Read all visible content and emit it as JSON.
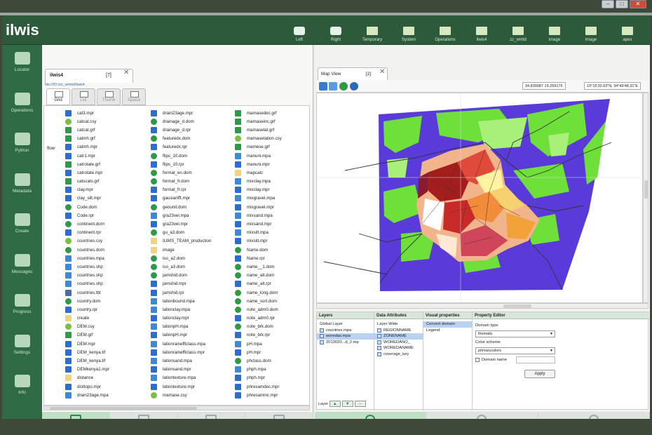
{
  "app": {
    "title": "ilwis"
  },
  "colors": {
    "header": "#2d5a3a",
    "sidebar": "#2f6b45",
    "accent": "#bfe0c4"
  },
  "topbar": [
    {
      "label": "Left",
      "icon": "camera-left-icon"
    },
    {
      "label": "Right",
      "icon": "camera-right-icon"
    },
    {
      "label": "Temporary",
      "icon": "folder-icon"
    },
    {
      "label": "System",
      "icon": "folder-icon"
    },
    {
      "label": "Operations",
      "icon": "folder-icon"
    },
    {
      "label": "ilwis4",
      "icon": "folder-icon"
    },
    {
      "label": "zz_wmtd",
      "icon": "folder-icon"
    },
    {
      "label": "image",
      "icon": "folder-icon"
    },
    {
      "label": "image",
      "icon": "folder-icon"
    },
    {
      "label": "apex",
      "icon": "folder-icon"
    }
  ],
  "sidebar": [
    {
      "label": "Locator",
      "icon": "locator-icon"
    },
    {
      "label": "Operations",
      "icon": "gears-icon"
    },
    {
      "label": "Python",
      "icon": "python-icon"
    },
    {
      "label": "Metadata",
      "icon": "tag-icon"
    },
    {
      "label": "Create",
      "icon": "create-icon"
    },
    {
      "label": "Messages",
      "icon": "message-icon"
    },
    {
      "label": "Progress",
      "icon": "progress-icon"
    },
    {
      "label": "Settings",
      "icon": "gear-icon"
    },
    {
      "label": "Info",
      "icon": "info-icon"
    }
  ],
  "catalog": {
    "tab_name": "ilwis4",
    "tab_count": "[7]",
    "path": "file:///D:/zz_wmtd/ilwis4",
    "side_label": "flow",
    "view_tabs": [
      "Grid",
      "List",
      "Thumb",
      "Spatial"
    ],
    "columns": [
      [
        {
          "name": "cat3.mpr",
          "type": "raster"
        },
        {
          "name": "catcat.csy",
          "type": "csy"
        },
        {
          "name": "catcat.grf",
          "type": "grf"
        },
        {
          "name": "catmh.grf",
          "type": "grf"
        },
        {
          "name": "catmh.mpr",
          "type": "raster"
        },
        {
          "name": "catr1.mpr",
          "type": "raster"
        },
        {
          "name": "catrotate.grf",
          "type": "grf"
        },
        {
          "name": "catrotate.mpr",
          "type": "raster"
        },
        {
          "name": "catscats.grf",
          "type": "grf"
        },
        {
          "name": "clay.mpr",
          "type": "raster"
        },
        {
          "name": "clay_silt.mpr",
          "type": "raster"
        },
        {
          "name": "Code.dom",
          "type": "dom"
        },
        {
          "name": "Code.rpr",
          "type": "rpr"
        },
        {
          "name": "continent.dom",
          "type": "dom"
        },
        {
          "name": "continent.rpr",
          "type": "rpr"
        },
        {
          "name": "countries.csy",
          "type": "csy"
        },
        {
          "name": "countries.dom",
          "type": "dom"
        },
        {
          "name": "countries.mpa",
          "type": "polygon"
        },
        {
          "name": "countries.shp",
          "type": "polygon"
        },
        {
          "name": "countries.shp",
          "type": "polygon"
        },
        {
          "name": "countries.shp",
          "type": "polygon"
        },
        {
          "name": "countries.tbt",
          "type": "table"
        },
        {
          "name": "country.dom",
          "type": "dom"
        },
        {
          "name": "country.rpr",
          "type": "rpr"
        },
        {
          "name": "create",
          "type": "folder"
        },
        {
          "name": "DEM.csy",
          "type": "csy"
        },
        {
          "name": "DEM.grf",
          "type": "grf"
        },
        {
          "name": "DEM.mpr",
          "type": "raster"
        },
        {
          "name": "DEM_kenya.tif",
          "type": "raster"
        },
        {
          "name": "DEM_kenya.tif",
          "type": "raster"
        },
        {
          "name": "DEMkenya1.mpr",
          "type": "raster"
        },
        {
          "name": "distance",
          "type": "folder"
        },
        {
          "name": "disttopo.mpr",
          "type": "raster"
        },
        {
          "name": "drain23age.mpa",
          "type": "polygon"
        }
      ],
      [
        {
          "name": "drain23age.mpr",
          "type": "raster"
        },
        {
          "name": "drainage_d.dom",
          "type": "dom"
        },
        {
          "name": "drainage_d.rpr",
          "type": "rpr"
        },
        {
          "name": "featuredx.dom",
          "type": "dom"
        },
        {
          "name": "featuredx.rpr",
          "type": "rpr"
        },
        {
          "name": "flips_10.dom",
          "type": "dom"
        },
        {
          "name": "flips_10.rpr",
          "type": "rpr"
        },
        {
          "name": "format_en.dom",
          "type": "dom"
        },
        {
          "name": "format_fr.dom",
          "type": "dom"
        },
        {
          "name": "format_fr.rpr",
          "type": "rpr"
        },
        {
          "name": "gausianfft.mpr",
          "type": "raster"
        },
        {
          "name": "geounit.dom",
          "type": "dom"
        },
        {
          "name": "gra23vel.mpa",
          "type": "polygon"
        },
        {
          "name": "gra23vel.mpr",
          "type": "raster"
        },
        {
          "name": "gu_a3.dom",
          "type": "dom"
        },
        {
          "name": "ILWIS_TEAM_production",
          "type": "folder"
        },
        {
          "name": "image",
          "type": "folder"
        },
        {
          "name": "iso_a2.dom",
          "type": "dom"
        },
        {
          "name": "iso_a3.dom",
          "type": "dom"
        },
        {
          "name": "jamshid.dom",
          "type": "dom"
        },
        {
          "name": "jamshid.mpr",
          "type": "raster"
        },
        {
          "name": "jamshid.rpr",
          "type": "rpr"
        },
        {
          "name": "lationbound.mpa",
          "type": "polygon"
        },
        {
          "name": "lationclay.mpa",
          "type": "polygon"
        },
        {
          "name": "lationclay.mpr",
          "type": "raster"
        },
        {
          "name": "lationpH.mpa",
          "type": "polygon"
        },
        {
          "name": "lationpH.mpr",
          "type": "raster"
        },
        {
          "name": "lationrainefficlass.mpa",
          "type": "polygon"
        },
        {
          "name": "lationrainefficlass.mpr",
          "type": "raster"
        },
        {
          "name": "lationsand.mpa",
          "type": "polygon"
        },
        {
          "name": "lationsand.mpr",
          "type": "raster"
        },
        {
          "name": "lationtexture.mpa",
          "type": "polygon"
        },
        {
          "name": "lationtexture.mpr",
          "type": "raster"
        },
        {
          "name": "mamase.csy",
          "type": "csy"
        }
      ],
      [
        {
          "name": "mamasedec.grf",
          "type": "grf"
        },
        {
          "name": "mamaseinc.grf",
          "type": "grf"
        },
        {
          "name": "mamaselat.grf",
          "type": "grf"
        },
        {
          "name": "mamasetation.csy",
          "type": "csy"
        },
        {
          "name": "mamese.grf",
          "type": "grf"
        },
        {
          "name": "manuni.mpa",
          "type": "polygon"
        },
        {
          "name": "manuni.mpr",
          "type": "raster"
        },
        {
          "name": "mapcalc",
          "type": "folder"
        },
        {
          "name": "mixclay.mpa",
          "type": "polygon"
        },
        {
          "name": "mixclay.mpr",
          "type": "raster"
        },
        {
          "name": "mixgravel.mpa",
          "type": "polygon"
        },
        {
          "name": "mixgravel.mpr",
          "type": "raster"
        },
        {
          "name": "mixsand.mpa",
          "type": "polygon"
        },
        {
          "name": "mixsand.mpr",
          "type": "raster"
        },
        {
          "name": "mixsilt.mpa",
          "type": "polygon"
        },
        {
          "name": "mixsilt.mpr",
          "type": "raster"
        },
        {
          "name": "Name.dom",
          "type": "dom"
        },
        {
          "name": "Name.rpr",
          "type": "rpr"
        },
        {
          "name": "name__1.dom",
          "type": "dom"
        },
        {
          "name": "name_alt.dom",
          "type": "dom"
        },
        {
          "name": "name_alt.rpr",
          "type": "rpr"
        },
        {
          "name": "name_long.dom",
          "type": "dom"
        },
        {
          "name": "name_sort.dom",
          "type": "dom"
        },
        {
          "name": "note_adm0.dom",
          "type": "dom"
        },
        {
          "name": "note_adm0.rpr",
          "type": "rpr"
        },
        {
          "name": "note_brk.dom",
          "type": "dom"
        },
        {
          "name": "note_brk.rpr",
          "type": "rpr"
        },
        {
          "name": "pH.mpa",
          "type": "polygon"
        },
        {
          "name": "pH.mpr",
          "type": "raster"
        },
        {
          "name": "phclass.dom",
          "type": "dom"
        },
        {
          "name": "phph.mpa",
          "type": "polygon"
        },
        {
          "name": "phph.mpr",
          "type": "raster"
        },
        {
          "name": "phresamdec.mpr",
          "type": "raster"
        },
        {
          "name": "phresaminc.mpr",
          "type": "raster"
        }
      ]
    ],
    "bottom_buttons": [
      "Filter",
      "Selection",
      "Copy",
      "Refresh"
    ]
  },
  "map": {
    "tab_name": "Map View",
    "tab_count": "[2]",
    "coord_xy": "34.830087 19.259176",
    "coord_dms": "19°15'33.03\"N, 34°49'48.31\"E",
    "panels": {
      "layers": {
        "title": "Layers",
        "items": [
          "Global Layer",
          "countries.mpa",
          "woredas.mpa",
          "2013020...d_2.mp"
        ],
        "selected": 2,
        "footer_label": "Layer"
      },
      "attributes": {
        "title": "Data Attributes",
        "items": [
          "Layer Wide",
          "REGIONNAME",
          "ZONENAME",
          "WOREDANO_",
          "WOREDANAME",
          "coverage_key"
        ],
        "selected": 2
      },
      "visual": {
        "title": "Visual properties",
        "items": [
          "Convert domain",
          "Legend"
        ],
        "selected": 0
      },
      "editor": {
        "title": "Property Editor",
        "domain_type_label": "Domain type",
        "domain_type_value": "thematic",
        "color_scheme_label": "Color scheme",
        "color_scheme_value": "primarycolors",
        "domain_name_label": "Domain name",
        "apply_label": "Apply"
      }
    },
    "bottom_buttons": [
      "Display Options",
      "Layers Info",
      "Metadata"
    ]
  }
}
